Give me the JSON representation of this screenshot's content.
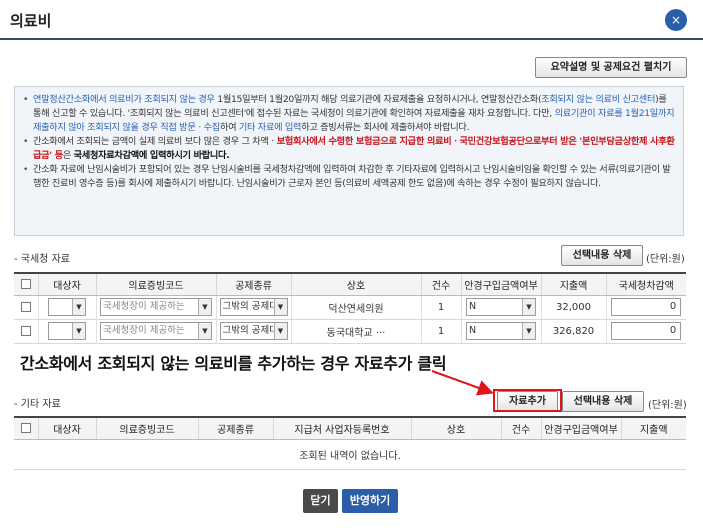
{
  "dialog": {
    "title": "의료비",
    "close_icon": "×"
  },
  "toolbar": {
    "summary_button": "요약설명 및 공제요건 펼치기"
  },
  "notice": {
    "item1": {
      "t1": "연말정산간소화에서 의료비가 조회되지 않는 경우",
      "t2": " 1월15일부터 1월20일까지 해당 의료기관에 자료제출을 요청하시거나, 연말정산간소화(",
      "t3": "조회되지 않는 의료비 신고센터",
      "t4": ")를 통해 신고할 수 있습니다. '조회되지 않는 의료비 신고센터'에 접수된 자료는 국세청이 의료기관에 확인하여 자료제출을 재차 요청합니다. 다만, ",
      "t5": "의료기관이 자료를 1월21일까지 제출하지 않아 조회되지 않을 경우 직접 방문ㆍ수집",
      "t6": "하여 ",
      "t7": "기타 자료에 입력",
      "t8": "하고 증빙서류는 회사에 제출하셔야 바랍니다."
    },
    "item2": {
      "t1": "간소화에서 조회되는 금액이 실제 의료비 보다 많은 경우 그 차액ㆍ",
      "t2": "보험회사에서 수령한 보험금으로 지급한 의료비ㆍ국민건강보험공단으로부터 받은 '본인부담금상한제 사후환급금' 등",
      "t3": "은 ",
      "t4": "국세청자료차감액에 입력하시기 바랍니다."
    },
    "item3": {
      "t1": "간소화 자료에 난임시술비가 포함되어 있는 경우 난임시술비를 국세청차감액에 입력하여 차감한 후 기타자료에 입력하시고 난임시술비임을 확인할 수 있는 서류(의료기관이 발행한 진료비 영수증 등)를 회사에 제출하시기 바랍니다. 난임시술비가 근로자 본인 등(의료비 세액공제 한도 없음)에 속하는 경우 수정이 필요하지 않습니다."
    }
  },
  "nts_section": {
    "label": "- 국세청 자료",
    "delete_button": "선택내용 삭제",
    "unit": "(단위:원)",
    "columns": [
      "대상자",
      "의료증빙코드",
      "공제종류",
      "상호",
      "건수",
      "안경구입금액여부",
      "지출액",
      "국세청차감액"
    ],
    "rows": [
      {
        "target": "",
        "code": "국세청장이 제공하는",
        "type": "그밖의 공제대상",
        "name": "덕산연세의원",
        "count": "1",
        "glasses": "N",
        "amount": "32,000",
        "deduction": "0"
      },
      {
        "target": "",
        "code": "국세청장이 제공하는",
        "type": "그밖의 공제대상",
        "name": "동국대학교 ···",
        "count": "1",
        "glasses": "N",
        "amount": "326,820",
        "deduction": "0"
      }
    ]
  },
  "annotation": {
    "text": "간소화에서 조회되지 않는 의료비를 추가하는 경우 자료추가 클릭"
  },
  "other_section": {
    "label": "- 기타 자료",
    "add_button": "자료추가",
    "delete_button": "선택내용 삭제",
    "unit": "(단위:원)",
    "columns": [
      "대상자",
      "의료증빙코드",
      "공제종류",
      "지급처 사업자등록번호",
      "상호",
      "건수",
      "안경구입금액여부",
      "지출액"
    ],
    "empty_message": "조회된 내역이 없습니다."
  },
  "footer": {
    "close_button": "닫기",
    "apply_button": "반영하기"
  },
  "colors": {
    "accent_blue": "#2b62b6",
    "warning_red": "#c8161d",
    "annotation_red": "#e0141b",
    "apply_button_bg": "#2b5ea8",
    "close_button_bg": "#4a4a4a"
  }
}
